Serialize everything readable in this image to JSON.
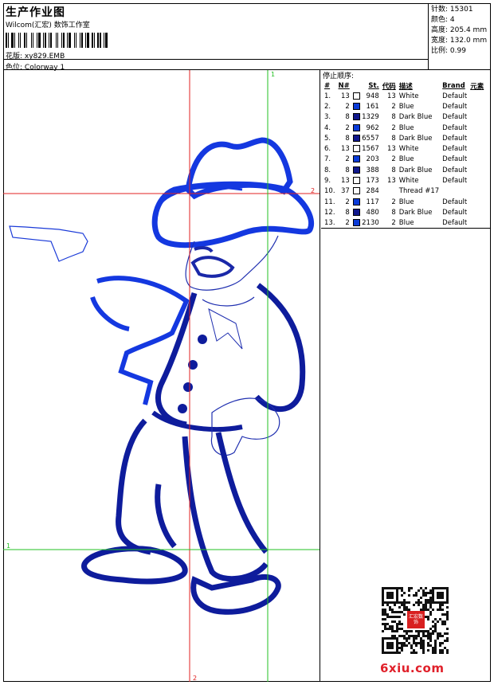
{
  "header": {
    "title": "生产作业图",
    "studio": "Wilcom(汇宏) 数饰工作室",
    "file_label": "花版:",
    "file_name": "xy829.EMB",
    "colorway_label": "色位:",
    "colorway_name": "Colorway 1"
  },
  "stats": {
    "stitches_label": "针数:",
    "stitches": "15301",
    "colors_label": "颜色:",
    "colors": "4",
    "height_label": "高度:",
    "height": "205.4 mm",
    "width_label": "宽度:",
    "width": "132.0 mm",
    "scale_label": "比例:",
    "scale": "0.99"
  },
  "stop_sequence": {
    "title": "停止顺序:",
    "columns": [
      "#",
      "N#",
      "St.",
      "代码",
      "描述",
      "Brand",
      "元素"
    ],
    "rows": [
      {
        "idx": "1.",
        "n": "13",
        "color": "#ffffff",
        "st": "948",
        "code": "13",
        "desc": "White",
        "brand": "Default"
      },
      {
        "idx": "2.",
        "n": "2",
        "color": "#0a3bd8",
        "st": "161",
        "code": "2",
        "desc": "Blue",
        "brand": "Default"
      },
      {
        "idx": "3.",
        "n": "8",
        "color": "#10188c",
        "st": "1329",
        "code": "8",
        "desc": "Dark Blue",
        "brand": "Default"
      },
      {
        "idx": "4.",
        "n": "2",
        "color": "#0a3bd8",
        "st": "962",
        "code": "2",
        "desc": "Blue",
        "brand": "Default"
      },
      {
        "idx": "5.",
        "n": "8",
        "color": "#10188c",
        "st": "6557",
        "code": "8",
        "desc": "Dark Blue",
        "brand": "Default"
      },
      {
        "idx": "6.",
        "n": "13",
        "color": "#ffffff",
        "st": "1567",
        "code": "13",
        "desc": "White",
        "brand": "Default"
      },
      {
        "idx": "7.",
        "n": "2",
        "color": "#0a3bd8",
        "st": "203",
        "code": "2",
        "desc": "Blue",
        "brand": "Default"
      },
      {
        "idx": "8.",
        "n": "8",
        "color": "#10188c",
        "st": "388",
        "code": "8",
        "desc": "Dark Blue",
        "brand": "Default"
      },
      {
        "idx": "9.",
        "n": "13",
        "color": "#ffffff",
        "st": "173",
        "code": "13",
        "desc": "White",
        "brand": "Default"
      },
      {
        "idx": "10.",
        "n": "37",
        "color": "#ffffff",
        "st": "284",
        "code": "",
        "desc": "Thread #17",
        "brand": ""
      },
      {
        "idx": "11.",
        "n": "2",
        "color": "#0a3bd8",
        "st": "117",
        "code": "2",
        "desc": "Blue",
        "brand": "Default"
      },
      {
        "idx": "12.",
        "n": "8",
        "color": "#10188c",
        "st": "480",
        "code": "8",
        "desc": "Dark Blue",
        "brand": "Default"
      },
      {
        "idx": "13.",
        "n": "2",
        "color": "#0a3bd8",
        "st": "2130",
        "code": "2",
        "desc": "Blue",
        "brand": "Default"
      }
    ]
  },
  "guides": {
    "v1_label": "1",
    "v2_label": "2",
    "h1_label": "1",
    "h2_label": "2",
    "v1_color": "#22c022",
    "h2_color": "#e02020"
  },
  "qr_seal": "汇宏数饰",
  "watermark": "6xiu.com"
}
